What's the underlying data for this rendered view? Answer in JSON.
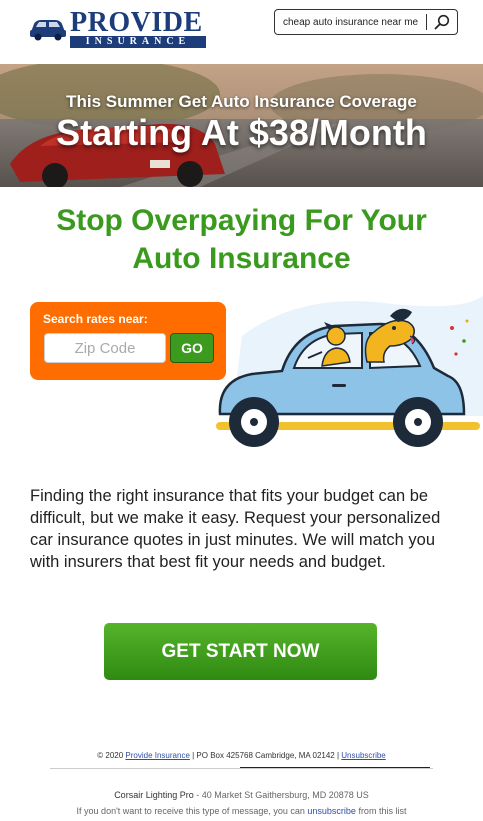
{
  "header": {
    "brand": "PROVIDE",
    "brand_sub": "INSURANCE",
    "search_value": "cheap auto insurance near me"
  },
  "hero": {
    "line1": "This Summer Get Auto Insurance Coverage",
    "line2": "Starting At $38/Month"
  },
  "headline": "Stop Overpaying For Your Auto Insurance",
  "rates_form": {
    "label": "Search rates near:",
    "zip_placeholder": "Zip Code",
    "go_label": "GO"
  },
  "body_text": "Finding the right insurance that fits your budget can be difficult, but we make it easy. Request your personalized car insurance quotes in just minutes. We will match you with insurers that best fit your needs and budget.",
  "cta_label": "GET START NOW",
  "footer": {
    "copyright": "© 2020",
    "brand_link": "Provide Insurance",
    "po_box": "| PO Box 425768 Cambridge, MA 02142 |",
    "unsubscribe": "Unsubscribe",
    "sender_name": "Corsair Lighting Pro",
    "sender_address": " - 40 Market St Gaithersburg, MD 20878 US",
    "optout_prefix": "If you don't want to receive this type of message, you can ",
    "optout_link": "unsubscribe",
    "optout_suffix": " from this list"
  },
  "colors": {
    "brand_blue": "#1d3c7a",
    "headline_green": "#3a9a1e",
    "rates_orange": "#ff6d00",
    "cta_green": "#2f8a12",
    "car_blue": "#8ec3e8"
  },
  "icons": [
    "car-logo-icon",
    "search-icon"
  ]
}
